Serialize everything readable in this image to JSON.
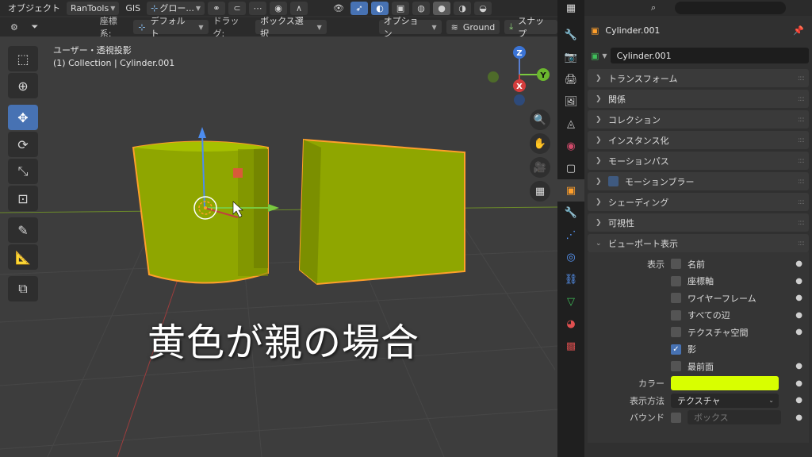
{
  "header": {
    "mode": "オブジェクト",
    "addon": "RanTools",
    "gis": "GIS",
    "orientation": "グロー...",
    "coord_label": "座標系:",
    "coord_value": "デフォルト",
    "drag_label": "ドラッグ:",
    "drag_value": "ボックス選択",
    "options": "オプション",
    "snap_target": "Ground",
    "snap": "スナップ"
  },
  "viewport": {
    "view_name": "ユーザー・透視投影",
    "collection_info": "(1) Collection | Cylinder.001",
    "overlay_caption": "黄色が親の場合",
    "axes": {
      "z": "Z",
      "y": "Y",
      "x": "X"
    },
    "object_color": "#8fa600"
  },
  "properties": {
    "object_title": "Cylinder.001",
    "object_name": "Cylinder.001",
    "sections": [
      {
        "label": "トランスフォーム"
      },
      {
        "label": "関係"
      },
      {
        "label": "コレクション"
      },
      {
        "label": "インスタンス化"
      },
      {
        "label": "モーションパス"
      },
      {
        "label": "モーションブラー",
        "checkbox": true
      },
      {
        "label": "シェーディング"
      },
      {
        "label": "可視性"
      }
    ],
    "viewport_display": {
      "title": "ビューポート表示",
      "show_label": "表示",
      "options": [
        {
          "label": "名前",
          "checked": false
        },
        {
          "label": "座標軸",
          "checked": false
        },
        {
          "label": "ワイヤーフレーム",
          "checked": false
        },
        {
          "label": "すべての辺",
          "checked": false
        },
        {
          "label": "テクスチャ空間",
          "checked": false
        },
        {
          "label": "影",
          "checked": true
        },
        {
          "label": "最前面",
          "checked": false
        }
      ],
      "color_label": "カラー",
      "color_value": "#d8ff00",
      "display_as_label": "表示方法",
      "display_as_value": "テクスチャ",
      "bounds_label": "バウンド",
      "bounds_value": "ボックス"
    }
  }
}
